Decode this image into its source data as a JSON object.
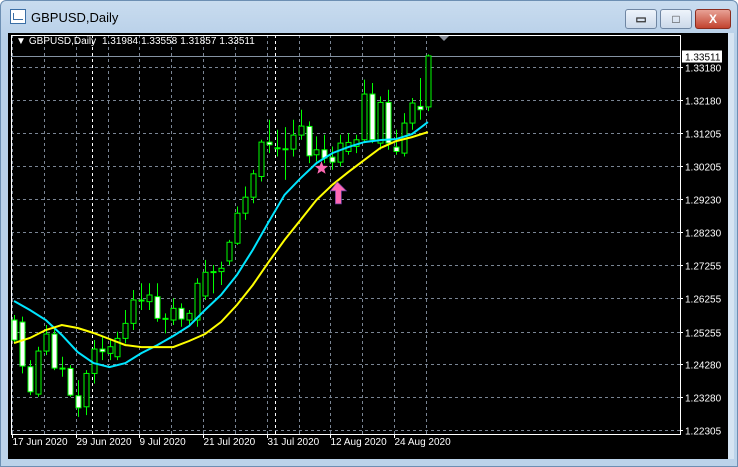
{
  "window": {
    "title": "GBPUSD,Daily",
    "buttons": {
      "minimize": "▭",
      "maximize": "□",
      "close": "X"
    }
  },
  "header": {
    "symbol": "GBPUSD,Daily",
    "open": "1.31984",
    "high": "1.33558",
    "low": "1.31857",
    "close": "1.33511"
  },
  "colors": {
    "background": "#000000",
    "bull_candle": "#00ff00",
    "bear_candle_fill": "#ffffff",
    "ma_fast": "#00e5ff",
    "ma_slow": "#ffff00",
    "grid": "#7a8594",
    "marker": "#ff69b4"
  },
  "chart_data": {
    "type": "candlestick",
    "symbol": "GBPUSD",
    "timeframe": "Daily",
    "ylim": [
      1.2215,
      1.3385
    ],
    "grid": true,
    "last_price": "1.33511",
    "y_ticks": [
      "1.33180",
      "1.32180",
      "1.31205",
      "1.30205",
      "1.29230",
      "1.28230",
      "1.27255",
      "1.26255",
      "1.25255",
      "1.24280",
      "1.23280",
      "1.22305"
    ],
    "x_tick_labels": [
      {
        "date": "2020-06-17",
        "label": "17 Jun 2020"
      },
      {
        "date": "2020-06-29",
        "label": "29 Jun 2020"
      },
      {
        "date": "2020-07-09",
        "label": "9 Jul 2020"
      },
      {
        "date": "2020-07-21",
        "label": "21 Jul 2020"
      },
      {
        "date": "2020-07-31",
        "label": "31 Jul 2020"
      },
      {
        "date": "2020-08-12",
        "label": "12 Aug 2020"
      },
      {
        "date": "2020-08-24",
        "label": "24 Aug 2020"
      }
    ],
    "period_separators": [
      "2020-07-01",
      "2020-08-03"
    ],
    "candles_columns": [
      "date",
      "open",
      "high",
      "low",
      "close"
    ],
    "candles": [
      [
        "2020-06-17",
        1.256,
        1.2575,
        1.249,
        1.25
      ],
      [
        "2020-06-18",
        1.2554,
        1.257,
        1.24,
        1.2422
      ],
      [
        "2020-06-19",
        1.242,
        1.244,
        1.2335,
        1.2345
      ],
      [
        "2020-06-22",
        1.2338,
        1.248,
        1.233,
        1.2467
      ],
      [
        "2020-06-23",
        1.2467,
        1.2545,
        1.2455,
        1.2518
      ],
      [
        "2020-06-24",
        1.2518,
        1.254,
        1.241,
        1.2416
      ],
      [
        "2020-06-25",
        1.2416,
        1.245,
        1.239,
        1.2414
      ],
      [
        "2020-06-26",
        1.2415,
        1.2425,
        1.233,
        1.2335
      ],
      [
        "2020-06-29",
        1.2333,
        1.238,
        1.227,
        1.2297
      ],
      [
        "2020-06-30",
        1.23,
        1.241,
        1.2275,
        1.24
      ],
      [
        "2020-07-01",
        1.24,
        1.25,
        1.237,
        1.2473
      ],
      [
        "2020-07-02",
        1.2473,
        1.251,
        1.244,
        1.2465
      ],
      [
        "2020-07-03",
        1.246,
        1.2505,
        1.244,
        1.248
      ],
      [
        "2020-07-06",
        1.245,
        1.2525,
        1.244,
        1.2505
      ],
      [
        "2020-07-07",
        1.2505,
        1.259,
        1.249,
        1.255
      ],
      [
        "2020-07-08",
        1.255,
        1.265,
        1.253,
        1.262
      ],
      [
        "2020-07-09",
        1.262,
        1.267,
        1.259,
        1.2619
      ],
      [
        "2020-07-10",
        1.2615,
        1.267,
        1.259,
        1.2635
      ],
      [
        "2020-07-13",
        1.263,
        1.267,
        1.2555,
        1.2565
      ],
      [
        "2020-07-14",
        1.2565,
        1.258,
        1.252,
        1.2564
      ],
      [
        "2020-07-15",
        1.256,
        1.2625,
        1.2545,
        1.2595
      ],
      [
        "2020-07-16",
        1.2595,
        1.261,
        1.254,
        1.2563
      ],
      [
        "2020-07-17",
        1.256,
        1.259,
        1.2545,
        1.258
      ],
      [
        "2020-07-20",
        1.256,
        1.2685,
        1.254,
        1.267
      ],
      [
        "2020-07-21",
        1.2632,
        1.274,
        1.262,
        1.2703
      ],
      [
        "2020-07-22",
        1.2705,
        1.2725,
        1.264,
        1.2704
      ],
      [
        "2020-07-23",
        1.2705,
        1.2735,
        1.2665,
        1.2715
      ],
      [
        "2020-07-24",
        1.2737,
        1.28,
        1.2725,
        1.2793
      ],
      [
        "2020-07-27",
        1.279,
        1.29,
        1.2785,
        1.288
      ],
      [
        "2020-07-28",
        1.288,
        1.296,
        1.286,
        1.2928
      ],
      [
        "2020-07-29",
        1.2928,
        1.301,
        1.291,
        1.2998
      ],
      [
        "2020-07-30",
        1.299,
        1.31,
        1.2975,
        1.3093
      ],
      [
        "2020-07-31",
        1.3093,
        1.316,
        1.306,
        1.3085
      ],
      [
        "2020-08-03",
        1.3075,
        1.313,
        1.305,
        1.3076
      ],
      [
        "2020-08-04",
        1.3072,
        1.3138,
        1.298,
        1.3073
      ],
      [
        "2020-08-05",
        1.3072,
        1.316,
        1.305,
        1.3114
      ],
      [
        "2020-08-06",
        1.3114,
        1.319,
        1.31,
        1.3141
      ],
      [
        "2020-08-07",
        1.314,
        1.3155,
        1.303,
        1.3052
      ],
      [
        "2020-08-10",
        1.3055,
        1.311,
        1.3035,
        1.307
      ],
      [
        "2020-08-11",
        1.307,
        1.3115,
        1.303,
        1.3045
      ],
      [
        "2020-08-12",
        1.3048,
        1.308,
        1.301,
        1.3033
      ],
      [
        "2020-08-13",
        1.3033,
        1.3115,
        1.302,
        1.309
      ],
      [
        "2020-08-14",
        1.3065,
        1.312,
        1.3055,
        1.3092
      ],
      [
        "2020-08-17",
        1.308,
        1.3115,
        1.306,
        1.31
      ],
      [
        "2020-08-18",
        1.31,
        1.328,
        1.309,
        1.3237
      ],
      [
        "2020-08-19",
        1.3237,
        1.327,
        1.309,
        1.31
      ],
      [
        "2020-08-20",
        1.309,
        1.323,
        1.307,
        1.3212
      ],
      [
        "2020-08-21",
        1.3212,
        1.325,
        1.307,
        1.309
      ],
      [
        "2020-08-24",
        1.3078,
        1.313,
        1.3055,
        1.3065
      ],
      [
        "2020-08-25",
        1.306,
        1.318,
        1.305,
        1.315
      ],
      [
        "2020-08-26",
        1.315,
        1.3225,
        1.313,
        1.321
      ],
      [
        "2020-08-27",
        1.32,
        1.3285,
        1.316,
        1.319
      ],
      [
        "2020-08-28",
        1.31984,
        1.33558,
        1.31857,
        1.33511
      ]
    ],
    "moving_averages": [
      {
        "color": "#00e5ff",
        "points": [
          [
            "2020-06-17",
            1.2617
          ],
          [
            "2020-06-19",
            1.259
          ],
          [
            "2020-06-23",
            1.256
          ],
          [
            "2020-06-25",
            1.2515
          ],
          [
            "2020-06-29",
            1.2464
          ],
          [
            "2020-07-01",
            1.2431
          ],
          [
            "2020-07-03",
            1.2419
          ],
          [
            "2020-07-07",
            1.2431
          ],
          [
            "2020-07-09",
            1.2461
          ],
          [
            "2020-07-13",
            1.2485
          ],
          [
            "2020-07-15",
            1.2512
          ],
          [
            "2020-07-17",
            1.2542
          ],
          [
            "2020-07-21",
            1.259
          ],
          [
            "2020-07-23",
            1.2635
          ],
          [
            "2020-07-27",
            1.2695
          ],
          [
            "2020-07-29",
            1.277
          ],
          [
            "2020-07-31",
            1.2854
          ],
          [
            "2020-08-04",
            1.2935
          ],
          [
            "2020-08-06",
            1.2985
          ],
          [
            "2020-08-10",
            1.303
          ],
          [
            "2020-08-12",
            1.306
          ],
          [
            "2020-08-14",
            1.3078
          ],
          [
            "2020-08-18",
            1.3093
          ],
          [
            "2020-08-20",
            1.3099
          ],
          [
            "2020-08-24",
            1.3102
          ],
          [
            "2020-08-26",
            1.3117
          ],
          [
            "2020-08-28",
            1.3153
          ]
        ]
      },
      {
        "color": "#ffff00",
        "points": [
          [
            "2020-06-17",
            1.2491
          ],
          [
            "2020-06-19",
            1.2506
          ],
          [
            "2020-06-23",
            1.253
          ],
          [
            "2020-06-25",
            1.2545
          ],
          [
            "2020-06-29",
            1.2536
          ],
          [
            "2020-07-01",
            1.2521
          ],
          [
            "2020-07-03",
            1.2503
          ],
          [
            "2020-07-07",
            1.2485
          ],
          [
            "2020-07-09",
            1.2479
          ],
          [
            "2020-07-13",
            1.2479
          ],
          [
            "2020-07-15",
            1.2479
          ],
          [
            "2020-07-17",
            1.2497
          ],
          [
            "2020-07-21",
            1.2518
          ],
          [
            "2020-07-23",
            1.2554
          ],
          [
            "2020-07-27",
            1.2605
          ],
          [
            "2020-07-29",
            1.2665
          ],
          [
            "2020-07-31",
            1.2734
          ],
          [
            "2020-08-04",
            1.28
          ],
          [
            "2020-08-06",
            1.286
          ],
          [
            "2020-08-10",
            1.292
          ],
          [
            "2020-08-12",
            1.2965
          ],
          [
            "2020-08-14",
            1.3003
          ],
          [
            "2020-08-18",
            1.3039
          ],
          [
            "2020-08-20",
            1.3075
          ],
          [
            "2020-08-24",
            1.3096
          ],
          [
            "2020-08-26",
            1.3108
          ],
          [
            "2020-08-28",
            1.3123
          ]
        ]
      }
    ],
    "annotations": [
      {
        "type": "star",
        "date": "2020-08-10",
        "price": 1.3015,
        "color": "#ff69b4"
      },
      {
        "type": "up-arrow",
        "date": "2020-08-12",
        "price": 1.295,
        "color": "#ff69b4"
      }
    ]
  }
}
